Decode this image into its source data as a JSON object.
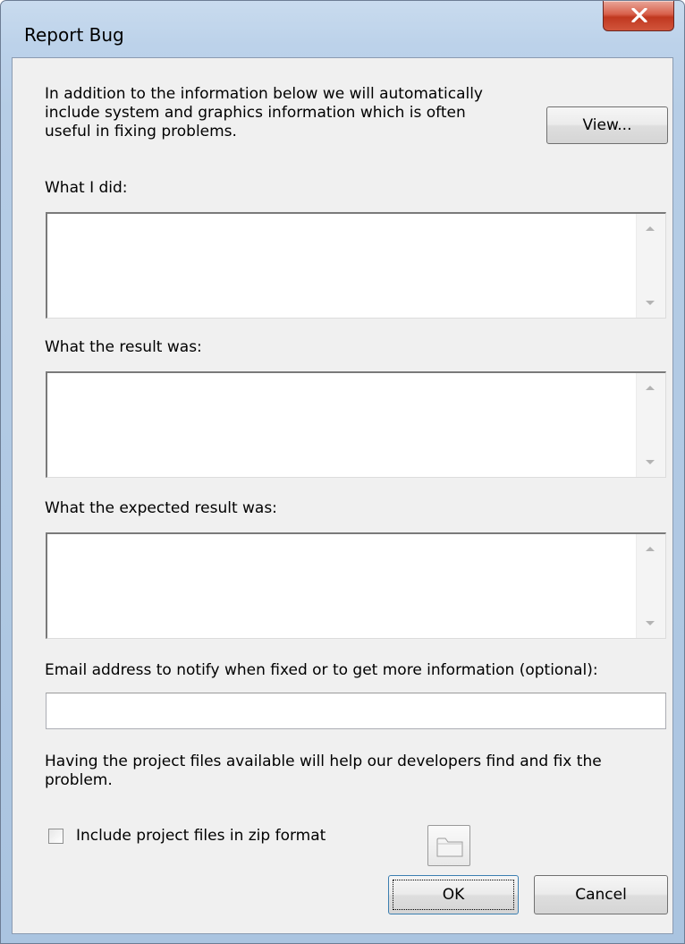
{
  "window": {
    "title": "Report Bug",
    "close_label": "X"
  },
  "intro": {
    "lines": [
      "In addition to the information below we will automatically",
      "include system and graphics information which is often",
      "useful in fixing problems."
    ]
  },
  "buttons": {
    "view": "View...",
    "ok": "OK",
    "cancel": "Cancel"
  },
  "fields": {
    "what_i_did": {
      "label": "What I did:",
      "value": ""
    },
    "result": {
      "label": "What the result was:",
      "value": ""
    },
    "expected": {
      "label": "What the expected result was:",
      "value": ""
    },
    "email": {
      "label": "Email address to notify when fixed or to get more information (optional):",
      "value": ""
    }
  },
  "project": {
    "lines": [
      "Having the project files available will help our developers find and fix the",
      "problem."
    ],
    "checkbox_label": "Include project files in zip format",
    "checked": false
  },
  "icons": {
    "close": "close-icon",
    "folder": "folder-icon",
    "scroll_up": "scroll-up-arrow-icon",
    "scroll_down": "scroll-down-arrow-icon"
  },
  "colors": {
    "frame": "#bcd2ea",
    "client": "#f0f0f0",
    "close_button": "#c7432b"
  }
}
